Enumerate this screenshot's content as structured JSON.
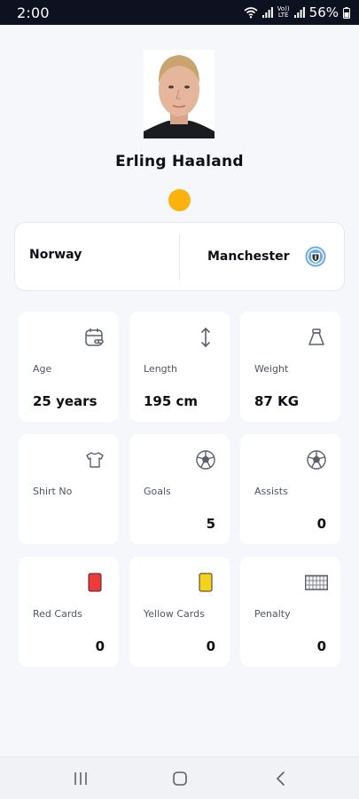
{
  "status_bar": {
    "time": "2:00",
    "battery": "56%",
    "network": "LTE"
  },
  "player": {
    "name": "Erling Haaland",
    "status_color": "#fbb20d"
  },
  "team": {
    "country": "Norway",
    "club": "Manchester"
  },
  "stats": [
    {
      "label": "Age",
      "value": "25 years",
      "icon": "calendar-link-icon"
    },
    {
      "label": "Length",
      "value": "195 cm",
      "icon": "height-arrow-icon"
    },
    {
      "label": "Weight",
      "value": "87 KG",
      "icon": "weight-icon"
    },
    {
      "label": "Shirt No",
      "value": "",
      "icon": "shirt-icon"
    },
    {
      "label": "Goals",
      "value": "5",
      "icon": "football-icon"
    },
    {
      "label": "Assists",
      "value": "0",
      "icon": "football-icon"
    },
    {
      "label": "Red Cards",
      "value": "0",
      "icon": "red-card-icon"
    },
    {
      "label": "Yellow Cards",
      "value": "0",
      "icon": "yellow-card-icon"
    },
    {
      "label": "Penalty",
      "value": "0",
      "icon": "goal-net-icon"
    }
  ],
  "colors": {
    "red_card": "#f03a3a",
    "yellow_card": "#f5d31c",
    "background": "#f6f7fb"
  }
}
